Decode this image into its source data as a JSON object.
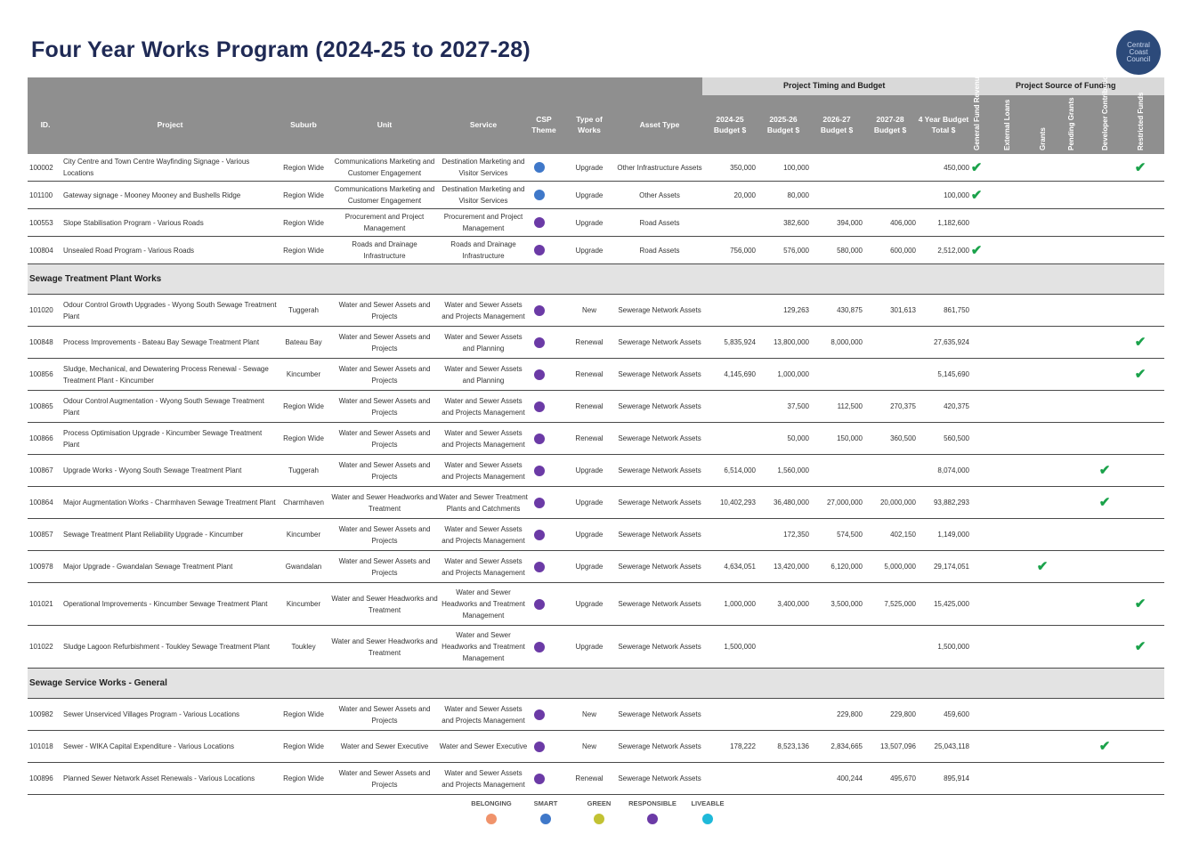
{
  "title": "Four Year Works Program (2024-25 to 2027-28)",
  "logo_text": "Central Coast Council",
  "groups": {
    "timing": "Project Timing and Budget",
    "funding": "Project Source of Funding"
  },
  "columns": {
    "id": "ID.",
    "project": "Project",
    "suburb": "Suburb",
    "unit": "Unit",
    "service": "Service",
    "csp": "CSP Theme",
    "type": "Type of Works",
    "asset": "Asset Type",
    "b1": "2024-25 Budget $",
    "b2": "2025-26 Budget $",
    "b3": "2026-27 Budget $",
    "b4": "2027-28 Budget $",
    "total": "4 Year Budget Total $",
    "f1": "General Fund Revenue",
    "f2": "External Loans",
    "f3": "Grants",
    "f4": "Pending Grants",
    "f5": "Developer Contributions",
    "f6": "Restricted Funds"
  },
  "colors": {
    "belonging": "#f0936b",
    "smart": "#3f78c9",
    "green": "#c2c233",
    "responsible": "#6b3aa6",
    "liveable": "#1fb9d9",
    "check": "#1aa24a",
    "header": "#8f8f8f"
  },
  "sections": [
    {
      "title": "",
      "rows": [
        {
          "id": "100002",
          "project": "City Centre and Town Centre Wayfinding Signage - Various Locations",
          "suburb": "Region Wide",
          "unit": "Communications Marketing and Customer Engagement",
          "service": "Destination Marketing and Visitor Services",
          "csp": "smart",
          "type": "Upgrade",
          "asset": "Other Infrastructure Assets",
          "b1": "350,000",
          "b2": "100,000",
          "b3": "",
          "b4": "",
          "total": "450,000",
          "funds": [
            true,
            false,
            false,
            false,
            false,
            true
          ]
        },
        {
          "id": "101100",
          "project": "Gateway signage - Mooney Mooney and Bushells Ridge",
          "suburb": "Region Wide",
          "unit": "Communications Marketing and Customer Engagement",
          "service": "Destination Marketing and Visitor Services",
          "csp": "smart",
          "type": "Upgrade",
          "asset": "Other Assets",
          "b1": "20,000",
          "b2": "80,000",
          "b3": "",
          "b4": "",
          "total": "100,000",
          "funds": [
            true,
            false,
            false,
            false,
            false,
            false
          ]
        },
        {
          "id": "100553",
          "project": "Slope Stabilisation Program - Various Roads",
          "suburb": "Region Wide",
          "unit": "Procurement and Project Management",
          "service": "Procurement and Project Management",
          "csp": "responsible",
          "type": "Upgrade",
          "asset": "Road Assets",
          "b1": "",
          "b2": "382,600",
          "b3": "394,000",
          "b4": "406,000",
          "total": "1,182,600",
          "funds": [
            false,
            false,
            false,
            false,
            false,
            false
          ]
        },
        {
          "id": "100804",
          "project": "Unsealed Road Program - Various Roads",
          "suburb": "Region Wide",
          "unit": "Roads and Drainage Infrastructure",
          "service": "Roads and Drainage Infrastructure",
          "csp": "responsible",
          "type": "Upgrade",
          "asset": "Road Assets",
          "b1": "756,000",
          "b2": "576,000",
          "b3": "580,000",
          "b4": "600,000",
          "total": "2,512,000",
          "funds": [
            true,
            false,
            false,
            false,
            false,
            false
          ]
        }
      ]
    },
    {
      "title": "Sewage Treatment Plant Works",
      "rows": [
        {
          "id": "101020",
          "project": "Odour Control Growth Upgrades - Wyong South Sewage Treatment Plant",
          "suburb": "Tuggerah",
          "unit": "Water and Sewer Assets and Projects",
          "service": "Water and Sewer Assets and Projects Management",
          "csp": "responsible",
          "type": "New",
          "asset": "Sewerage Network Assets",
          "b1": "",
          "b2": "129,263",
          "b3": "430,875",
          "b4": "301,613",
          "total": "861,750",
          "funds": [
            false,
            false,
            false,
            false,
            false,
            false
          ]
        },
        {
          "id": "100848",
          "project": "Process Improvements - Bateau Bay Sewage Treatment Plant",
          "suburb": "Bateau Bay",
          "unit": "Water and Sewer Assets and Projects",
          "service": "Water and Sewer Assets and Planning",
          "csp": "responsible",
          "type": "Renewal",
          "asset": "Sewerage Network Assets",
          "b1": "5,835,924",
          "b2": "13,800,000",
          "b3": "8,000,000",
          "b4": "",
          "total": "27,635,924",
          "funds": [
            false,
            false,
            false,
            false,
            false,
            true
          ]
        },
        {
          "id": "100856",
          "project": "Sludge, Mechanical, and Dewatering Process Renewal - Sewage Treatment Plant - Kincumber",
          "suburb": "Kincumber",
          "unit": "Water and Sewer Assets and Projects",
          "service": "Water and Sewer Assets and Planning",
          "csp": "responsible",
          "type": "Renewal",
          "asset": "Sewerage Network Assets",
          "b1": "4,145,690",
          "b2": "1,000,000",
          "b3": "",
          "b4": "",
          "total": "5,145,690",
          "funds": [
            false,
            false,
            false,
            false,
            false,
            true
          ]
        },
        {
          "id": "100865",
          "project": " Odour Control Augmentation - Wyong South Sewage Treatment Plant",
          "suburb": "Region Wide",
          "unit": "Water and Sewer Assets and Projects",
          "service": "Water and Sewer Assets and Projects Management",
          "csp": "responsible",
          "type": "Renewal",
          "asset": "Sewerage Network Assets",
          "b1": "",
          "b2": "37,500",
          "b3": "112,500",
          "b4": "270,375",
          "total": "420,375",
          "funds": [
            false,
            false,
            false,
            false,
            false,
            false
          ]
        },
        {
          "id": "100866",
          "project": "Process Optimisation Upgrade - Kincumber Sewage Treatment Plant",
          "suburb": "Region Wide",
          "unit": "Water and Sewer Assets and Projects",
          "service": "Water and Sewer Assets and Projects Management",
          "csp": "responsible",
          "type": "Renewal",
          "asset": "Sewerage Network Assets",
          "b1": "",
          "b2": "50,000",
          "b3": "150,000",
          "b4": "360,500",
          "total": "560,500",
          "funds": [
            false,
            false,
            false,
            false,
            false,
            false
          ]
        },
        {
          "id": "100867",
          "project": "Upgrade Works - Wyong South Sewage Treatment Plant",
          "suburb": "Tuggerah",
          "unit": "Water and Sewer Assets and Projects",
          "service": "Water and Sewer Assets and Projects Management",
          "csp": "responsible",
          "type": "Upgrade",
          "asset": "Sewerage Network Assets",
          "b1": "6,514,000",
          "b2": "1,560,000",
          "b3": "",
          "b4": "",
          "total": "8,074,000",
          "funds": [
            false,
            false,
            false,
            false,
            true,
            false
          ]
        },
        {
          "id": "100864",
          "project": "Major Augmentation Works - Charmhaven Sewage Treatment Plant",
          "suburb": "Charmhaven",
          "unit": "Water and Sewer Headworks and Treatment",
          "service": "Water and Sewer Treatment Plants and Catchments",
          "csp": "responsible",
          "type": "Upgrade",
          "asset": "Sewerage Network Assets",
          "b1": "10,402,293",
          "b2": "36,480,000",
          "b3": "27,000,000",
          "b4": "20,000,000",
          "total": "93,882,293",
          "funds": [
            false,
            false,
            false,
            false,
            true,
            false
          ]
        },
        {
          "id": "100857",
          "project": "Sewage Treatment Plant Reliability Upgrade - Kincumber",
          "suburb": "Kincumber",
          "unit": "Water and Sewer Assets and Projects",
          "service": "Water and Sewer Assets and Projects Management",
          "csp": "responsible",
          "type": "Upgrade",
          "asset": "Sewerage Network Assets",
          "b1": "",
          "b2": "172,350",
          "b3": "574,500",
          "b4": "402,150",
          "total": "1,149,000",
          "funds": [
            false,
            false,
            false,
            false,
            false,
            false
          ]
        },
        {
          "id": "100978",
          "project": "Major Upgrade - Gwandalan Sewage Treatment Plant",
          "suburb": "Gwandalan",
          "unit": "Water and Sewer Assets and Projects",
          "service": "Water and Sewer Assets and Projects Management",
          "csp": "responsible",
          "type": "Upgrade",
          "asset": "Sewerage Network Assets",
          "b1": "4,634,051",
          "b2": "13,420,000",
          "b3": "6,120,000",
          "b4": "5,000,000",
          "total": "29,174,051",
          "funds": [
            false,
            false,
            true,
            false,
            false,
            false
          ]
        },
        {
          "id": "101021",
          "project": "Operational Improvements - Kincumber Sewage Treatment Plant",
          "suburb": "Kincumber",
          "unit": "Water and Sewer Headworks and Treatment",
          "service": "Water and Sewer Headworks and Treatment Management",
          "csp": "responsible",
          "type": "Upgrade",
          "asset": "Sewerage Network Assets",
          "b1": "1,000,000",
          "b2": "3,400,000",
          "b3": "3,500,000",
          "b4": "7,525,000",
          "total": "15,425,000",
          "funds": [
            false,
            false,
            false,
            false,
            false,
            true
          ]
        },
        {
          "id": "101022",
          "project": "Sludge Lagoon Refurbishment - Toukley Sewage Treatment Plant",
          "suburb": "Toukley",
          "unit": "Water and Sewer Headworks and Treatment",
          "service": "Water and Sewer Headworks and Treatment Management",
          "csp": "responsible",
          "type": "Upgrade",
          "asset": "Sewerage Network Assets",
          "b1": "1,500,000",
          "b2": "",
          "b3": "",
          "b4": "",
          "total": "1,500,000",
          "funds": [
            false,
            false,
            false,
            false,
            false,
            true
          ]
        }
      ]
    },
    {
      "title": "Sewage Service Works - General",
      "rows": [
        {
          "id": "100982",
          "project": "Sewer Unserviced Villages Program - Various Locations",
          "suburb": "Region Wide",
          "unit": "Water and Sewer Assets and Projects",
          "service": "Water and Sewer Assets and Projects Management",
          "csp": "responsible",
          "type": "New",
          "asset": "Sewerage Network Assets",
          "b1": "",
          "b2": "",
          "b3": "229,800",
          "b4": "229,800",
          "total": "459,600",
          "funds": [
            false,
            false,
            false,
            false,
            false,
            false
          ]
        },
        {
          "id": "101018",
          "project": "Sewer - WIKA Capital Expenditure - Various Locations",
          "suburb": "Region Wide",
          "unit": "Water and Sewer Executive",
          "service": "Water and Sewer Executive",
          "csp": "responsible",
          "type": "New",
          "asset": "Sewerage Network Assets",
          "b1": "178,222",
          "b2": "8,523,136",
          "b3": "2,834,665",
          "b4": "13,507,096",
          "total": "25,043,118",
          "funds": [
            false,
            false,
            false,
            false,
            true,
            false
          ]
        },
        {
          "id": "100896",
          "project": "Planned Sewer Network Asset Renewals - Various Locations",
          "suburb": "Region Wide",
          "unit": "Water and Sewer Assets and Projects",
          "service": "Water and Sewer Assets and Projects Management",
          "csp": "responsible",
          "type": "Renewal",
          "asset": "Sewerage Network Assets",
          "b1": "",
          "b2": "",
          "b3": "400,244",
          "b4": "495,670",
          "total": "895,914",
          "funds": [
            false,
            false,
            false,
            false,
            false,
            false
          ]
        }
      ]
    }
  ],
  "check_glyph": "✔",
  "legend": [
    {
      "label": "BELONGING",
      "key": "belonging"
    },
    {
      "label": "SMART",
      "key": "smart"
    },
    {
      "label": "GREEN",
      "key": "green"
    },
    {
      "label": "RESPONSIBLE",
      "key": "responsible"
    },
    {
      "label": "LIVEABLE",
      "key": "liveable"
    }
  ]
}
